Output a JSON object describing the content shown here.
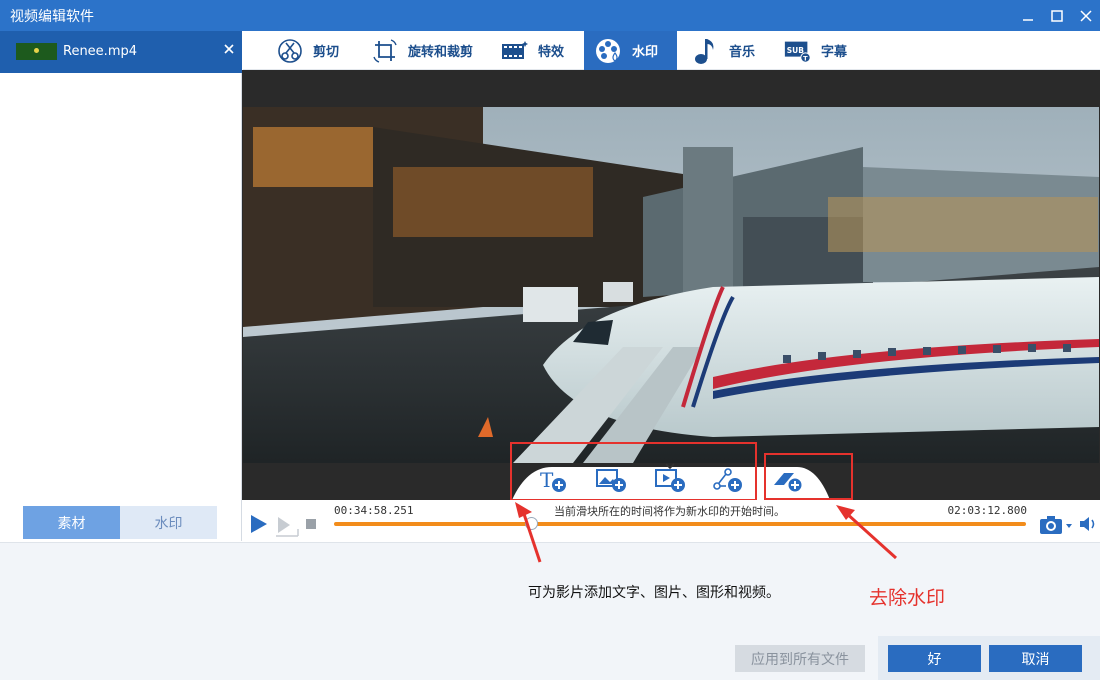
{
  "window": {
    "title": "视频编辑软件"
  },
  "file": {
    "name": "Renee.mp4"
  },
  "left_tabs": [
    {
      "label": "素材",
      "active": true
    },
    {
      "label": "水印",
      "active": false
    }
  ],
  "toolbar": {
    "items": [
      {
        "label": "剪切",
        "icon": "scissors-icon"
      },
      {
        "label": "旋转和裁剪",
        "icon": "crop-rotate-icon"
      },
      {
        "label": "特效",
        "icon": "film-effects-icon"
      },
      {
        "label": "水印",
        "icon": "film-reel-drop-icon",
        "active": true
      },
      {
        "label": "音乐",
        "icon": "music-note-icon"
      },
      {
        "label": "字幕",
        "icon": "subtitle-icon"
      }
    ]
  },
  "player": {
    "time_start": "00:34:58.251",
    "time_end": "02:03:12.800",
    "hint": "当前滑块所在的时间将作为新水印的开始时间。",
    "slider_position": 0.285
  },
  "watermark_buttons": [
    "add-text-watermark-icon",
    "add-image-watermark-icon",
    "add-video-watermark-icon",
    "add-shape-watermark-icon",
    "remove-watermark-icon"
  ],
  "annotations": {
    "add": "可为影片添加文字、图片、图形和视频。",
    "remove": "去除水印"
  },
  "buttons": {
    "apply_all": "应用到所有文件",
    "ok": "好",
    "cancel": "取消"
  },
  "colors": {
    "accent": "#2a6cc0",
    "title_bar": "#2c73c9",
    "timeline": "#f28c1b",
    "annotation_red": "#e5322d"
  }
}
